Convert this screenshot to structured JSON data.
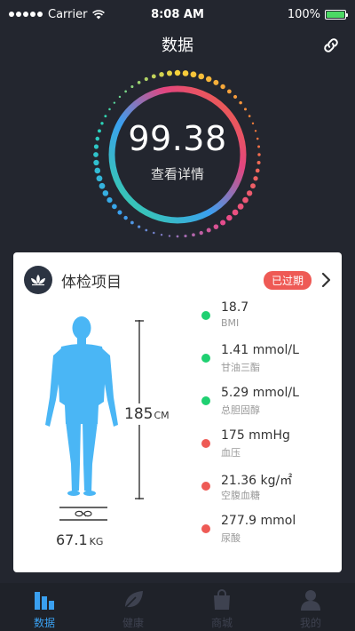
{
  "status_bar": {
    "carrier": "Carrier",
    "time": "8:08 AM",
    "battery": "100%",
    "battery_level": 1.0
  },
  "nav": {
    "title": "数据"
  },
  "score": {
    "value": "99.38",
    "link_label": "查看详情"
  },
  "card": {
    "title": "体检项目",
    "badge": "已过期",
    "height_value": "185",
    "height_unit": "CM",
    "weight_value": "67.1",
    "weight_unit": "KG",
    "metrics": [
      {
        "value": "18.7",
        "label": "BMI",
        "status_color": "#1fd071"
      },
      {
        "value": "1.41 mmol/L",
        "label": "甘油三酯",
        "status_color": "#1fd071"
      },
      {
        "value": "5.29 mmol/L",
        "label": "总胆固醇",
        "status_color": "#1fd071"
      },
      {
        "value": "175 mmHg",
        "label": "血压",
        "status_color": "#ee5a55"
      },
      {
        "value": "21.36 kg/㎡",
        "label": "空腹血糖",
        "status_color": "#ee5a55"
      },
      {
        "value": "277.9 mmol",
        "label": "尿酸",
        "status_color": "#ee5a55"
      }
    ]
  },
  "tabs": [
    {
      "label": "数据",
      "icon": "bar-chart-icon",
      "active": true
    },
    {
      "label": "健康",
      "icon": "leaf-icon",
      "active": false
    },
    {
      "label": "商城",
      "icon": "shopping-bag-icon",
      "active": false
    },
    {
      "label": "我的",
      "icon": "user-icon",
      "active": false
    }
  ],
  "colors": {
    "background": "#23262f",
    "accent_blue": "#3aa0f0",
    "status_green": "#1fd071",
    "status_red": "#ee5a55",
    "badge_red": "#ee5a55",
    "body_blue": "#4ab6f5"
  }
}
